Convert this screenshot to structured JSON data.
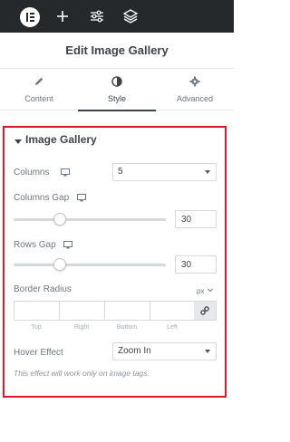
{
  "header": {
    "title": "Edit Image Gallery"
  },
  "tabs": [
    {
      "label": "Content",
      "icon": "pencil-icon",
      "active": false
    },
    {
      "label": "Style",
      "icon": "contrast-icon",
      "active": true
    },
    {
      "label": "Advanced",
      "icon": "gear-icon",
      "active": false
    }
  ],
  "section": {
    "title": "Image Gallery",
    "columns": {
      "label": "Columns",
      "value": "5"
    },
    "columns_gap": {
      "label": "Columns Gap",
      "value": "30"
    },
    "rows_gap": {
      "label": "Rows Gap",
      "value": "30"
    },
    "border_radius": {
      "label": "Border Radius",
      "unit": "px",
      "top": "Top",
      "right": "Right",
      "bottom": "Bottom",
      "left": "Left"
    },
    "hover_effect": {
      "label": "Hover Effect",
      "value": "Zoom In"
    },
    "note": "This effect will work only on image tags."
  },
  "colors": {
    "highlight_border": "#d6182a",
    "topbar": "#26292c"
  }
}
